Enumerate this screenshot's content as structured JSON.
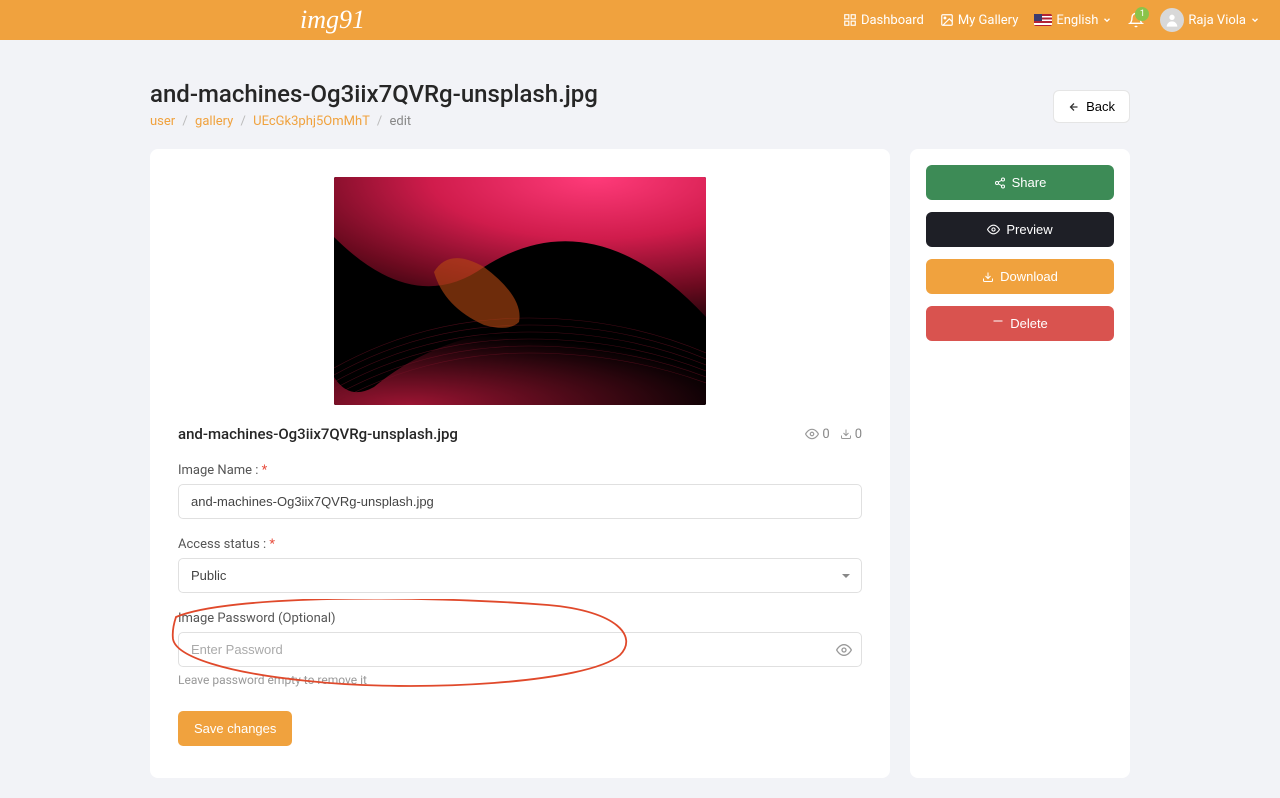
{
  "header": {
    "logo": "img91",
    "dashboard": "Dashboard",
    "gallery": "My Gallery",
    "language": "English",
    "notification_count": "1",
    "user_name": "Raja Viola"
  },
  "page": {
    "title": "and-machines-Og3iix7QVRg-unsplash.jpg",
    "back": "Back"
  },
  "breadcrumb": {
    "user": "user",
    "gallery": "gallery",
    "id": "UEcGk3phj5OmMhT",
    "edit": "edit"
  },
  "image": {
    "name": "and-machines-Og3iix7QVRg-unsplash.jpg",
    "views": "0",
    "downloads": "0"
  },
  "form": {
    "name_label": "Image Name :",
    "name_value": "and-machines-Og3iix7QVRg-unsplash.jpg",
    "access_label": "Access status :",
    "access_value": "Public",
    "password_label": "Image Password (Optional)",
    "password_placeholder": "Enter Password",
    "password_hint": "Leave password empty to remove it",
    "save": "Save changes"
  },
  "sidebar": {
    "share": "Share",
    "preview": "Preview",
    "download": "Download",
    "delete": "Delete"
  }
}
